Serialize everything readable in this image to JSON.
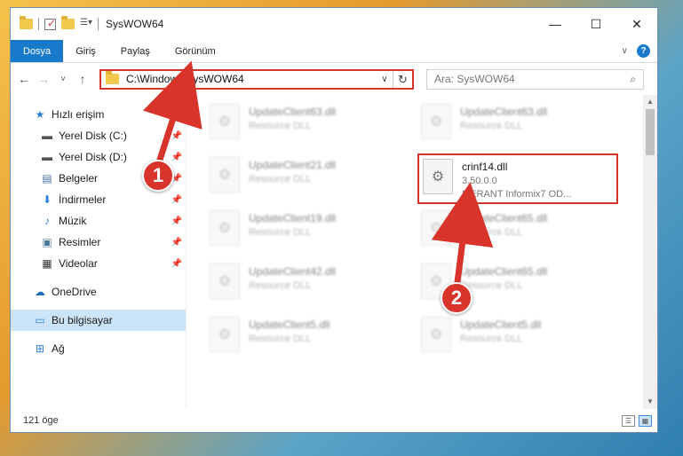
{
  "window": {
    "title": "SysWOW64"
  },
  "window_controls": {
    "minimize": "—",
    "maximize": "☐",
    "close": "✕"
  },
  "ribbon": {
    "tabs": [
      "Dosya",
      "Giriş",
      "Paylaş",
      "Görünüm"
    ],
    "help": "?"
  },
  "nav": {
    "back": "←",
    "forward": "→",
    "recent": "˅",
    "up": "↑",
    "address": "C:\\Windows\\SysWOW64",
    "search_placeholder": "Ara: SysWOW64"
  },
  "sidebar": {
    "quick_access": "Hızlı erişim",
    "items": [
      {
        "label": "Yerel Disk (C:)",
        "icon": "drive-icon"
      },
      {
        "label": "Yerel Disk (D:)",
        "icon": "drive-icon"
      },
      {
        "label": "Belgeler",
        "icon": "documents-icon"
      },
      {
        "label": "İndirmeler",
        "icon": "downloads-icon"
      },
      {
        "label": "Müzik",
        "icon": "music-icon"
      },
      {
        "label": "Resimler",
        "icon": "pictures-icon"
      },
      {
        "label": "Videolar",
        "icon": "videos-icon"
      }
    ],
    "onedrive": "OneDrive",
    "this_pc": "Bu bilgisayar",
    "network": "Ağ"
  },
  "files": {
    "left_column": [
      {
        "name": "UpdateClient63.dll",
        "type": "Resource DLL"
      },
      {
        "name": "UpdateClient21.dll",
        "type": "Resource DLL"
      },
      {
        "name": "UpdateClient19.dll",
        "type": "Resource DLL"
      },
      {
        "name": "UpdateClient42.dll",
        "type": "Resource DLL"
      },
      {
        "name": "UpdateClient5.dll",
        "type": "Resource DLL"
      }
    ],
    "right_column": [
      {
        "name": "UpdateClient63.dll",
        "type": "Resource DLL"
      },
      {
        "name": "UpdateClient65.dll",
        "type": "Resource DLL"
      },
      {
        "name": "UpdateClient65.dll",
        "type": "Resource DLL"
      },
      {
        "name": "UpdateClient5.dll",
        "type": "Resource DLL"
      }
    ],
    "highlighted": {
      "name": "crinf14.dll",
      "version": "3.50.0.0",
      "description": "MERANT Informix7 OD..."
    }
  },
  "status": {
    "item_count": "121 öge"
  },
  "annotations": {
    "step1": "1",
    "step2": "2",
    "color": "#d9342b"
  }
}
